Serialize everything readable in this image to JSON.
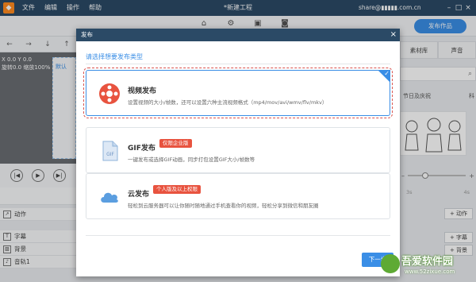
{
  "app": {
    "title": "*新建工程",
    "menu": [
      "文件",
      "编辑",
      "操作",
      "帮助"
    ],
    "user_email": "share@▮▮▮▮▮.com.cn",
    "window_buttons": [
      "–",
      "□",
      "×"
    ],
    "publish_work_label": "发布作品"
  },
  "toolbar": {
    "icons": [
      "home-icon",
      "settings-icon",
      "save-icon",
      "preview-icon"
    ]
  },
  "left_panel": {
    "nav_arrows": [
      "←",
      "→",
      "↓",
      "↑"
    ],
    "coord_line1": "X 0.0  Y 0.0",
    "coord_line2": "旋转0.0  缩放100%",
    "canvas_label": "默认",
    "tracks": [
      {
        "label": "动作"
      },
      {
        "label": "字幕"
      },
      {
        "label": "背景"
      },
      {
        "label": "音轨1"
      }
    ]
  },
  "right_panel": {
    "tabs": [
      "素材库",
      "声音"
    ],
    "categories": [
      "节日及庆祝",
      "科"
    ],
    "zoom_minus": "–",
    "zoom_plus": "+",
    "ruler_ticks": [
      "3s",
      "4s"
    ],
    "buttons": [
      "+ 动作",
      "+ 字幕",
      "+ 背景"
    ]
  },
  "dialog": {
    "title": "发布",
    "close": "×",
    "prompt": "请选择想要发布类型",
    "options": [
      {
        "title": "视频发布",
        "desc": "设置视频的大小/帧数，还可以设置六种主流视频格式（mp4/mov/avi/wmv/flv/mkv）",
        "badge": "",
        "selected": true
      },
      {
        "title": "GIF发布",
        "desc": "一键发布或选择GIF动画，同步打包设置GIF大小/帧数等",
        "badge": "仅限企业版",
        "selected": false
      },
      {
        "title": "云发布",
        "desc": "轻松到云服务器可以让你随时随地通过手机查看你的视频，轻松分享到微信和朋友圈",
        "badge": "个人版及以上权限",
        "selected": false
      }
    ],
    "next_button": "下一步"
  },
  "watermark": {
    "title": "吾爱软件园",
    "url": "www.52zixue.com"
  },
  "colors": {
    "accent": "#3a8ee6",
    "titlebar": "#2b4a66",
    "badge": "#e8533f"
  }
}
